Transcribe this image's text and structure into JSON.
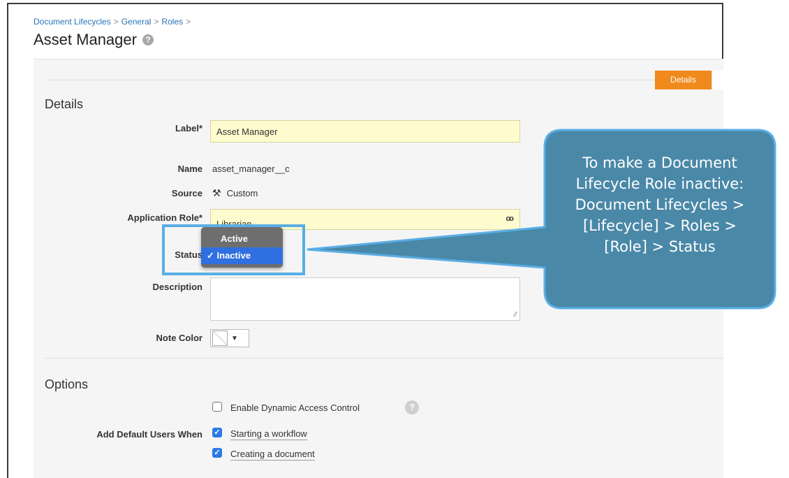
{
  "breadcrumb": {
    "items": [
      "Document Lifecycles",
      "General",
      "Roles"
    ],
    "separator": ">"
  },
  "page": {
    "title": "Asset Manager",
    "help_glyph": "?"
  },
  "tabs": {
    "details": "Details"
  },
  "details": {
    "section_title": "Details",
    "label": {
      "label": "Label*",
      "value": "Asset Manager"
    },
    "name": {
      "label": "Name",
      "value": "asset_manager__c"
    },
    "source": {
      "label": "Source",
      "value": "Custom",
      "icon": "hammer-icon"
    },
    "application_role": {
      "label": "Application Role*",
      "value": "Librarian",
      "icon": "binoculars-icon"
    },
    "status": {
      "label": "Status",
      "options": [
        "Active",
        "Inactive"
      ],
      "selected": "Inactive",
      "check": "✓"
    },
    "description": {
      "label": "Description",
      "value": ""
    },
    "note_color": {
      "label": "Note Color"
    }
  },
  "options": {
    "section_title": "Options",
    "dynamic_access": {
      "label": "Enable Dynamic Access Control",
      "checked": false
    },
    "add_default_users": {
      "label": "Add Default Users When",
      "items": [
        {
          "label": "Starting a workflow",
          "checked": true
        },
        {
          "label": "Creating a document",
          "checked": true
        }
      ]
    }
  },
  "callout": {
    "lines": [
      "To make a Document",
      "Lifecycle Role inactive:",
      "Document Lifecycles >",
      "[Lifecycle] > Roles >",
      "[Role] > Status"
    ]
  },
  "colors": {
    "accent_tab": "#f08a1c",
    "callout_fill": "#4a88a8",
    "callout_border": "#5aaee5",
    "field_bg": "#fefbcf",
    "link": "#2873b8"
  }
}
